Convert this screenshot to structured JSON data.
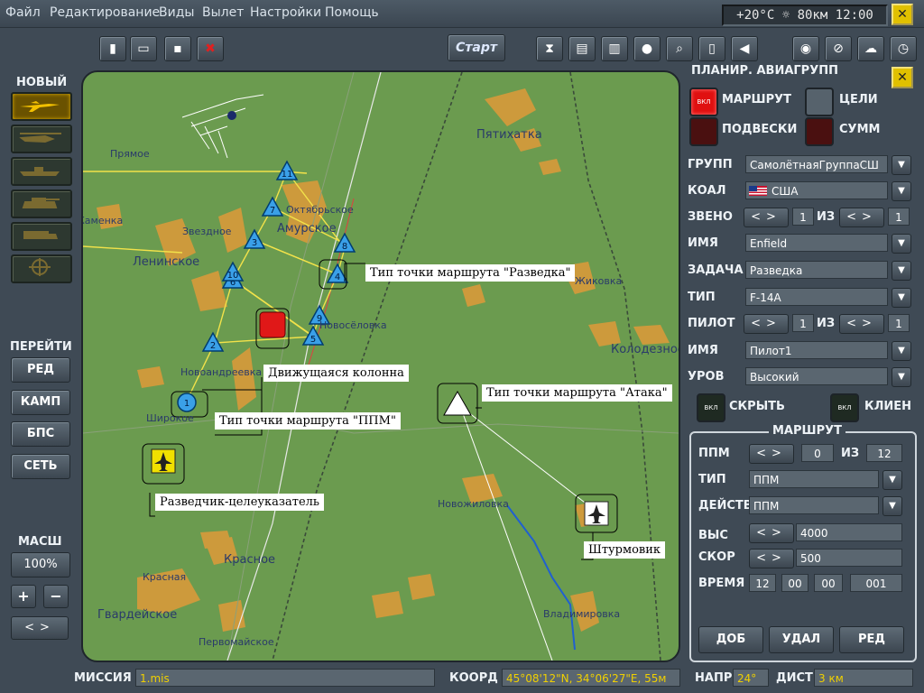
{
  "menu": [
    "Файл",
    "Редактирование",
    "Виды",
    "Вылет",
    "Настройки",
    "Помощь"
  ],
  "weather": "+20°C ☼ 80км 12:00",
  "toolbar": {
    "start_label": "Старт"
  },
  "left": {
    "new_label": "НОВЫЙ",
    "goto_label": "ПЕРЕЙТИ",
    "goto_buttons": [
      "РЕД",
      "КАМП",
      "БПС",
      "СЕТЬ"
    ],
    "scale_label": "МАСШ",
    "zoom": "100%",
    "zoom_in": "+",
    "zoom_out": "−"
  },
  "map": {
    "towns": {
      "pyatikhatka": "Пятихатка",
      "pryamoe": "Прямое",
      "oktyabrskoe": "Октябрьское",
      "amurskoe": "Амурское",
      "kamenka": "Каменка",
      "zvezdnoe": "Звездное",
      "leninskoe": "Ленинское",
      "zhikovka": "Жиковка",
      "novosyolovka": "Новосёловка",
      "novoandreevka": "Новоандреевка",
      "shirokoe": "Широкое",
      "kolodeznoe": "Колодезное",
      "novozhilovka": "Новожиловка",
      "krasnoe": "Красное",
      "krasnaya": "Красная",
      "gvardeyskoe": "Гвардейское",
      "pervomayskoe": "Первомайское",
      "vladimirovka": "Владимировка"
    },
    "waypoints": [
      "1",
      "2",
      "3",
      "4",
      "5",
      "6",
      "7",
      "8",
      "9",
      "10",
      "11"
    ],
    "callouts": {
      "recon": "Тип точки маршрута \"Разведка\"",
      "column": "Движущаяся колонна",
      "attack": "Тип точки маршрута \"Атака\"",
      "ppm": "Тип точки маршрута \"ППМ\"",
      "scout": "Разведчик-целеуказатель",
      "attacker": "Штурмовик"
    }
  },
  "panel": {
    "title": "ПЛАНИР. АВИАГРУПП",
    "toggle_on_text": "ВКЛ",
    "route_label": "МАРШРУТ",
    "targets_label": "ЦЕЛИ",
    "loadout_label": "ПОДВЕСКИ",
    "summ_label": "СУММ",
    "group": {
      "label": "ГРУПП",
      "value": "СамолётнаяГруппаСШ"
    },
    "coalition": {
      "label": "КОАЛ",
      "value": "США"
    },
    "flight": {
      "label": "ЗВЕНО",
      "value": "1",
      "of": "ИЗ",
      "total": "1"
    },
    "name": {
      "label": "ИМЯ",
      "value": "Enfield"
    },
    "task": {
      "label": "ЗАДАЧА",
      "value": "Разведка"
    },
    "type": {
      "label": "ТИП",
      "value": "F-14A"
    },
    "pilot": {
      "label": "ПИЛОТ",
      "value": "1",
      "of": "ИЗ",
      "total": "1"
    },
    "pilot_name": {
      "label": "ИМЯ",
      "value": "Пилот1"
    },
    "level": {
      "label": "УРОВ",
      "value": "Высокий"
    },
    "hide_label": "СКРЫТЬ",
    "client_label": "КЛИЕН"
  },
  "route": {
    "title": "МАРШРУТ",
    "wp": {
      "label": "ППМ",
      "value": "0",
      "of": "ИЗ",
      "total": "12"
    },
    "type": {
      "label": "ТИП",
      "value": "ППМ"
    },
    "action": {
      "label": "ДЕЙСТВ",
      "value": "ППМ"
    },
    "alt": {
      "label": "ВЫС",
      "value": "4000"
    },
    "speed": {
      "label": "СКОР",
      "value": "500"
    },
    "time": {
      "label": "ВРЕМЯ",
      "h": "12",
      "m": "00",
      "s": "00",
      "ms": "001"
    },
    "add": "ДОБ",
    "del": "УДАЛ",
    "edit": "РЕД"
  },
  "status": {
    "mission_label": "МИССИЯ",
    "mission": "1.mis",
    "coord_label": "КООРД",
    "coord": "45°08'12\"N, 34°06'27\"E, 55м",
    "heading_label": "НАПР",
    "heading": "24°",
    "dist_label": "ДИСТ",
    "dist": "3 км"
  }
}
